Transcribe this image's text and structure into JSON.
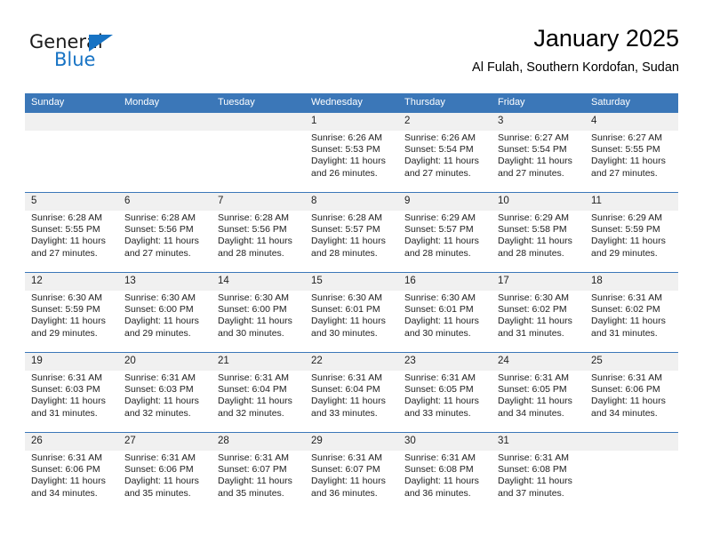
{
  "brand": {
    "name_top": "General",
    "name_bottom": "Blue",
    "triangle_icon": "triangle-icon",
    "accent_color": "#1773c4"
  },
  "header": {
    "title": "January 2025",
    "subtitle": "Al Fulah, Southern Kordofan, Sudan"
  },
  "theme": {
    "header_bg": "#3b77b8",
    "daynum_bg": "#f0f0f0",
    "text": "#222222"
  },
  "calendar": {
    "weekday_headers": [
      "Sunday",
      "Monday",
      "Tuesday",
      "Wednesday",
      "Thursday",
      "Friday",
      "Saturday"
    ],
    "weeks": [
      [
        {
          "day": "",
          "sunrise": "",
          "sunset": "",
          "daylight_line1": "",
          "daylight_line2": "",
          "empty": true
        },
        {
          "day": "",
          "sunrise": "",
          "sunset": "",
          "daylight_line1": "",
          "daylight_line2": "",
          "empty": true
        },
        {
          "day": "",
          "sunrise": "",
          "sunset": "",
          "daylight_line1": "",
          "daylight_line2": "",
          "empty": true
        },
        {
          "day": "1",
          "sunrise": "Sunrise: 6:26 AM",
          "sunset": "Sunset: 5:53 PM",
          "daylight_line1": "Daylight: 11 hours",
          "daylight_line2": "and 26 minutes."
        },
        {
          "day": "2",
          "sunrise": "Sunrise: 6:26 AM",
          "sunset": "Sunset: 5:54 PM",
          "daylight_line1": "Daylight: 11 hours",
          "daylight_line2": "and 27 minutes."
        },
        {
          "day": "3",
          "sunrise": "Sunrise: 6:27 AM",
          "sunset": "Sunset: 5:54 PM",
          "daylight_line1": "Daylight: 11 hours",
          "daylight_line2": "and 27 minutes."
        },
        {
          "day": "4",
          "sunrise": "Sunrise: 6:27 AM",
          "sunset": "Sunset: 5:55 PM",
          "daylight_line1": "Daylight: 11 hours",
          "daylight_line2": "and 27 minutes."
        }
      ],
      [
        {
          "day": "5",
          "sunrise": "Sunrise: 6:28 AM",
          "sunset": "Sunset: 5:55 PM",
          "daylight_line1": "Daylight: 11 hours",
          "daylight_line2": "and 27 minutes."
        },
        {
          "day": "6",
          "sunrise": "Sunrise: 6:28 AM",
          "sunset": "Sunset: 5:56 PM",
          "daylight_line1": "Daylight: 11 hours",
          "daylight_line2": "and 27 minutes."
        },
        {
          "day": "7",
          "sunrise": "Sunrise: 6:28 AM",
          "sunset": "Sunset: 5:56 PM",
          "daylight_line1": "Daylight: 11 hours",
          "daylight_line2": "and 28 minutes."
        },
        {
          "day": "8",
          "sunrise": "Sunrise: 6:28 AM",
          "sunset": "Sunset: 5:57 PM",
          "daylight_line1": "Daylight: 11 hours",
          "daylight_line2": "and 28 minutes."
        },
        {
          "day": "9",
          "sunrise": "Sunrise: 6:29 AM",
          "sunset": "Sunset: 5:57 PM",
          "daylight_line1": "Daylight: 11 hours",
          "daylight_line2": "and 28 minutes."
        },
        {
          "day": "10",
          "sunrise": "Sunrise: 6:29 AM",
          "sunset": "Sunset: 5:58 PM",
          "daylight_line1": "Daylight: 11 hours",
          "daylight_line2": "and 28 minutes."
        },
        {
          "day": "11",
          "sunrise": "Sunrise: 6:29 AM",
          "sunset": "Sunset: 5:59 PM",
          "daylight_line1": "Daylight: 11 hours",
          "daylight_line2": "and 29 minutes."
        }
      ],
      [
        {
          "day": "12",
          "sunrise": "Sunrise: 6:30 AM",
          "sunset": "Sunset: 5:59 PM",
          "daylight_line1": "Daylight: 11 hours",
          "daylight_line2": "and 29 minutes."
        },
        {
          "day": "13",
          "sunrise": "Sunrise: 6:30 AM",
          "sunset": "Sunset: 6:00 PM",
          "daylight_line1": "Daylight: 11 hours",
          "daylight_line2": "and 29 minutes."
        },
        {
          "day": "14",
          "sunrise": "Sunrise: 6:30 AM",
          "sunset": "Sunset: 6:00 PM",
          "daylight_line1": "Daylight: 11 hours",
          "daylight_line2": "and 30 minutes."
        },
        {
          "day": "15",
          "sunrise": "Sunrise: 6:30 AM",
          "sunset": "Sunset: 6:01 PM",
          "daylight_line1": "Daylight: 11 hours",
          "daylight_line2": "and 30 minutes."
        },
        {
          "day": "16",
          "sunrise": "Sunrise: 6:30 AM",
          "sunset": "Sunset: 6:01 PM",
          "daylight_line1": "Daylight: 11 hours",
          "daylight_line2": "and 30 minutes."
        },
        {
          "day": "17",
          "sunrise": "Sunrise: 6:30 AM",
          "sunset": "Sunset: 6:02 PM",
          "daylight_line1": "Daylight: 11 hours",
          "daylight_line2": "and 31 minutes."
        },
        {
          "day": "18",
          "sunrise": "Sunrise: 6:31 AM",
          "sunset": "Sunset: 6:02 PM",
          "daylight_line1": "Daylight: 11 hours",
          "daylight_line2": "and 31 minutes."
        }
      ],
      [
        {
          "day": "19",
          "sunrise": "Sunrise: 6:31 AM",
          "sunset": "Sunset: 6:03 PM",
          "daylight_line1": "Daylight: 11 hours",
          "daylight_line2": "and 31 minutes."
        },
        {
          "day": "20",
          "sunrise": "Sunrise: 6:31 AM",
          "sunset": "Sunset: 6:03 PM",
          "daylight_line1": "Daylight: 11 hours",
          "daylight_line2": "and 32 minutes."
        },
        {
          "day": "21",
          "sunrise": "Sunrise: 6:31 AM",
          "sunset": "Sunset: 6:04 PM",
          "daylight_line1": "Daylight: 11 hours",
          "daylight_line2": "and 32 minutes."
        },
        {
          "day": "22",
          "sunrise": "Sunrise: 6:31 AM",
          "sunset": "Sunset: 6:04 PM",
          "daylight_line1": "Daylight: 11 hours",
          "daylight_line2": "and 33 minutes."
        },
        {
          "day": "23",
          "sunrise": "Sunrise: 6:31 AM",
          "sunset": "Sunset: 6:05 PM",
          "daylight_line1": "Daylight: 11 hours",
          "daylight_line2": "and 33 minutes."
        },
        {
          "day": "24",
          "sunrise": "Sunrise: 6:31 AM",
          "sunset": "Sunset: 6:05 PM",
          "daylight_line1": "Daylight: 11 hours",
          "daylight_line2": "and 34 minutes."
        },
        {
          "day": "25",
          "sunrise": "Sunrise: 6:31 AM",
          "sunset": "Sunset: 6:06 PM",
          "daylight_line1": "Daylight: 11 hours",
          "daylight_line2": "and 34 minutes."
        }
      ],
      [
        {
          "day": "26",
          "sunrise": "Sunrise: 6:31 AM",
          "sunset": "Sunset: 6:06 PM",
          "daylight_line1": "Daylight: 11 hours",
          "daylight_line2": "and 34 minutes."
        },
        {
          "day": "27",
          "sunrise": "Sunrise: 6:31 AM",
          "sunset": "Sunset: 6:06 PM",
          "daylight_line1": "Daylight: 11 hours",
          "daylight_line2": "and 35 minutes."
        },
        {
          "day": "28",
          "sunrise": "Sunrise: 6:31 AM",
          "sunset": "Sunset: 6:07 PM",
          "daylight_line1": "Daylight: 11 hours",
          "daylight_line2": "and 35 minutes."
        },
        {
          "day": "29",
          "sunrise": "Sunrise: 6:31 AM",
          "sunset": "Sunset: 6:07 PM",
          "daylight_line1": "Daylight: 11 hours",
          "daylight_line2": "and 36 minutes."
        },
        {
          "day": "30",
          "sunrise": "Sunrise: 6:31 AM",
          "sunset": "Sunset: 6:08 PM",
          "daylight_line1": "Daylight: 11 hours",
          "daylight_line2": "and 36 minutes."
        },
        {
          "day": "31",
          "sunrise": "Sunrise: 6:31 AM",
          "sunset": "Sunset: 6:08 PM",
          "daylight_line1": "Daylight: 11 hours",
          "daylight_line2": "and 37 minutes."
        },
        {
          "day": "",
          "sunrise": "",
          "sunset": "",
          "daylight_line1": "",
          "daylight_line2": "",
          "empty": true
        }
      ]
    ]
  }
}
